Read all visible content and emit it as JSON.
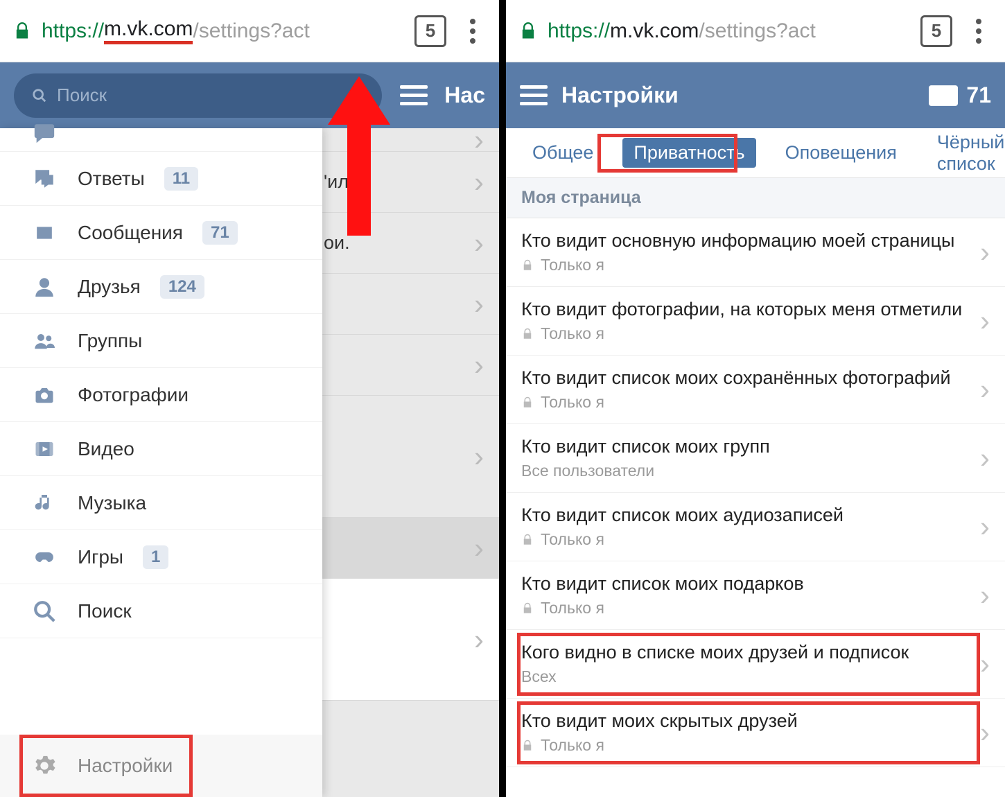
{
  "browser": {
    "https": "https://",
    "host_underlined": "m.vk.com",
    "path": "/settings?act",
    "tab_count": "5"
  },
  "left": {
    "search_placeholder": "Поиск",
    "header_title_partial": "Нас",
    "bg_fragments": {
      "a": "'ил.",
      "b": "ои."
    },
    "sidebar": {
      "items": [
        {
          "label": "Ответы",
          "badge": "11",
          "icon": "answers"
        },
        {
          "label": "Сообщения",
          "badge": "71",
          "icon": "mail"
        },
        {
          "label": "Друзья",
          "badge": "124",
          "icon": "friend"
        },
        {
          "label": "Группы",
          "badge": "",
          "icon": "groups"
        },
        {
          "label": "Фотографии",
          "badge": "",
          "icon": "camera"
        },
        {
          "label": "Видео",
          "badge": "",
          "icon": "video"
        },
        {
          "label": "Музыка",
          "badge": "",
          "icon": "music"
        },
        {
          "label": "Игры",
          "badge": "1",
          "icon": "games"
        },
        {
          "label": "Поиск",
          "badge": "",
          "icon": "search"
        }
      ],
      "footer_label": "Настройки"
    }
  },
  "right": {
    "header_title": "Настройки",
    "mail_count": "71",
    "tabs": {
      "general": "Общее",
      "privacy": "Приватность",
      "notify": "Оповещения",
      "blacklist": "Чёрный список"
    },
    "section": "Моя страница",
    "rows": [
      {
        "title": "Кто видит основную информацию моей страницы",
        "sub": "Только я",
        "lock": true
      },
      {
        "title": "Кто видит фотографии, на которых меня отметили",
        "sub": "Только я",
        "lock": true
      },
      {
        "title": "Кто видит список моих сохранённых фотографий",
        "sub": "Только я",
        "lock": true
      },
      {
        "title": "Кто видит список моих групп",
        "sub": "Все пользователи",
        "lock": false
      },
      {
        "title": "Кто видит список моих аудиозаписей",
        "sub": "Только я",
        "lock": true
      },
      {
        "title": "Кто видит список моих подарков",
        "sub": "Только я",
        "lock": true
      },
      {
        "title": "Кого видно в списке моих друзей и подписок",
        "sub": "Всех",
        "lock": false
      },
      {
        "title": "Кто видит моих скрытых друзей",
        "sub": "Только я",
        "lock": true
      }
    ]
  }
}
